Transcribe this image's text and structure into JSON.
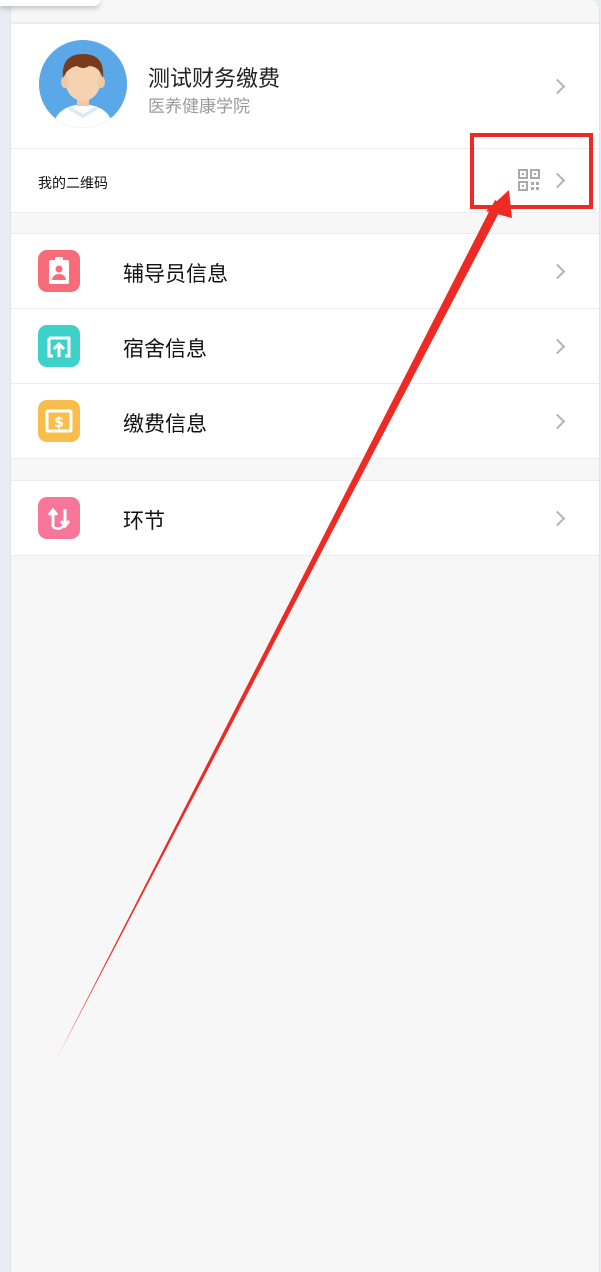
{
  "profile": {
    "name": "测试财务缴费",
    "school": "医养健康学院"
  },
  "qr": {
    "label": "我的二维码"
  },
  "menu": [
    {
      "label": "辅导员信息",
      "icon": "id-badge-icon",
      "color": "#f76c78"
    },
    {
      "label": "宿舍信息",
      "icon": "upload-box-icon",
      "color": "#3ed1c9"
    },
    {
      "label": "缴费信息",
      "icon": "dollar-card-icon",
      "color": "#f9bd4c"
    }
  ],
  "menu2": [
    {
      "label": "环节",
      "icon": "swap-arrows-icon",
      "color": "#f7769a"
    }
  ],
  "annotation": {
    "color": "#ee2a24"
  }
}
